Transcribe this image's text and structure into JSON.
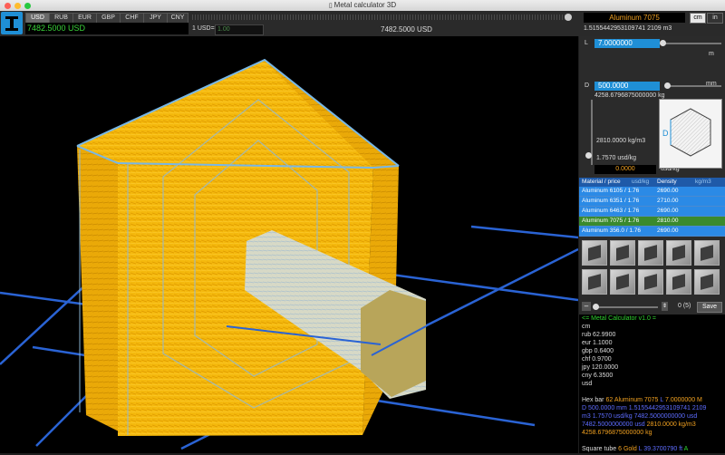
{
  "window": {
    "title": "Metal calculator 3D"
  },
  "currencies": [
    "USD",
    "RUB",
    "EUR",
    "GBP",
    "CHF",
    "JPY",
    "CNY"
  ],
  "selected_currency": "USD",
  "balance": "7482.5000 USD",
  "usd_label": "1 USD=",
  "usd_rate": "1.00",
  "center_total": "7482.5000 USD",
  "material_name": "Aluminum 7075",
  "units": {
    "cm": "cm",
    "in": "in"
  },
  "volume": "1.5155442953109741 2109 m3",
  "params": {
    "L_label": "L",
    "L_value": "7.0000000",
    "D_label": "D",
    "D_value": "500.0000",
    "mm": "mm",
    "m": "m",
    "weight": "4258.6796875000000 kg",
    "density": "2810.0000 kg/m3",
    "price_per_kg": "1.7570 usd/kg",
    "price_input": "0.0000",
    "price_unit": "usd/kg",
    "preview_letter": "D"
  },
  "table": {
    "headers": [
      "Material / price",
      "usd/kg",
      "Density",
      "kg/m3"
    ],
    "rows": [
      {
        "name": "Aluminum 6105 / 1.76",
        "density": "2690.00",
        "state": "normal"
      },
      {
        "name": "Aluminum 6351 / 1.76",
        "density": "2710.00",
        "state": "normal"
      },
      {
        "name": "Aluminum 6463 / 1.76",
        "density": "2690.00",
        "state": "normal"
      },
      {
        "name": "Aluminum 7075 / 1.76",
        "density": "2810.00",
        "state": "selected"
      },
      {
        "name": "Aluminum 356.0 / 1.76",
        "density": "2690.00",
        "state": "normal"
      }
    ]
  },
  "bottom": {
    "minus": "–",
    "plus": "+",
    "count": "0 (5)",
    "save": "Save"
  },
  "console": {
    "header": "<= Metal Calculator v1.0 =",
    "lines": [
      "cm",
      "rub 62.9900",
      "eur 1.1000",
      "gbp 0.6400",
      "chf 0.9700",
      "jpy 120.0000",
      "cny 6.3500",
      "usd"
    ],
    "hex1": "Hex bar",
    "hex2": "62 Aluminum 7075",
    "hex3": "L",
    "hex4": "7.0000000 M",
    "hex5": "D",
    "hex6": "500.0000 mm",
    "hex7": "1.5155442953109741 2109",
    "hex8": "m3",
    "hex9": "1.7570 usd/kg",
    "hex10": "7482.5000000000 usd",
    "hex11": "7482.5000000000 usd",
    "hex12": "2810.0000 kg/m3",
    "hex13": "4258.6796875000000 kg",
    "sq1": "Square tube",
    "sq2": "6 Gold",
    "sq3": "L 39.3700790 ft",
    "sq4": "A"
  },
  "colors": {
    "accent": "#1f8fd6",
    "selected_row": "#3a8a2e",
    "balance": "#39d439",
    "material": "#f0a020"
  }
}
